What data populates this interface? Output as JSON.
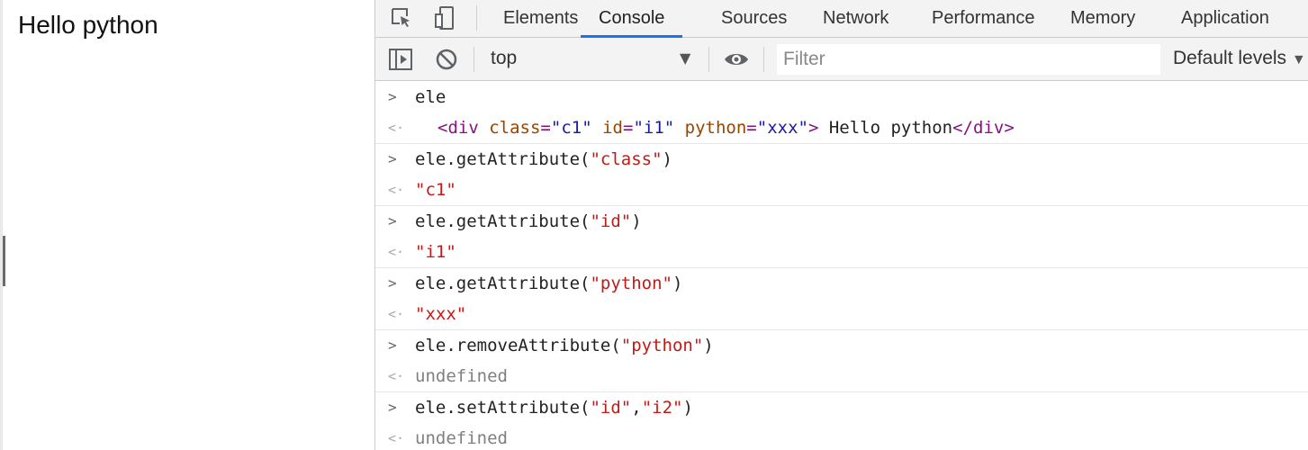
{
  "page": {
    "text": "Hello python"
  },
  "devtools": {
    "tabs": [
      "Elements",
      "Console",
      "Sources",
      "Network",
      "Performance",
      "Memory",
      "Application"
    ],
    "active_tab": "Console",
    "toolbar": {
      "context": "top",
      "filter_placeholder": "Filter",
      "levels": "Default levels"
    }
  },
  "console": {
    "entry0": {
      "input": "ele",
      "out": {
        "t1": "<div",
        "a1": "class",
        "e1": "=",
        "v1": "\"c1\"",
        "a2": "id",
        "e2": "=",
        "v2": "\"i1\"",
        "a3": "python",
        "e3": "=",
        "v3": "\"xxx\"",
        "t2": ">",
        "text": " Hello python",
        "t3": "</div>"
      }
    },
    "entry1": {
      "in_a": "ele.getAttribute(",
      "in_s": "\"class\"",
      "in_b": ")",
      "out": "\"c1\""
    },
    "entry2": {
      "in_a": "ele.getAttribute(",
      "in_s": "\"id\"",
      "in_b": ")",
      "out": "\"i1\""
    },
    "entry3": {
      "in_a": "ele.getAttribute(",
      "in_s": "\"python\"",
      "in_b": ")",
      "out": "\"xxx\""
    },
    "entry4": {
      "in_a": "ele.removeAttribute(",
      "in_s": "\"python\"",
      "in_b": ")",
      "out": "undefined"
    },
    "entry5": {
      "in_a": "ele.setAttribute(",
      "in_s": "\"id\"",
      "in_c": ",",
      "in_s2": "\"i2\"",
      "in_b": ")",
      "out": "undefined"
    },
    "prompt_glyph": ">",
    "result_glyph": "<·"
  },
  "colors": {
    "active_tab_underline": "#1a73e8",
    "string": "#c41a16",
    "tag": "#881280",
    "attr": "#994500",
    "undefined": "#808080"
  }
}
